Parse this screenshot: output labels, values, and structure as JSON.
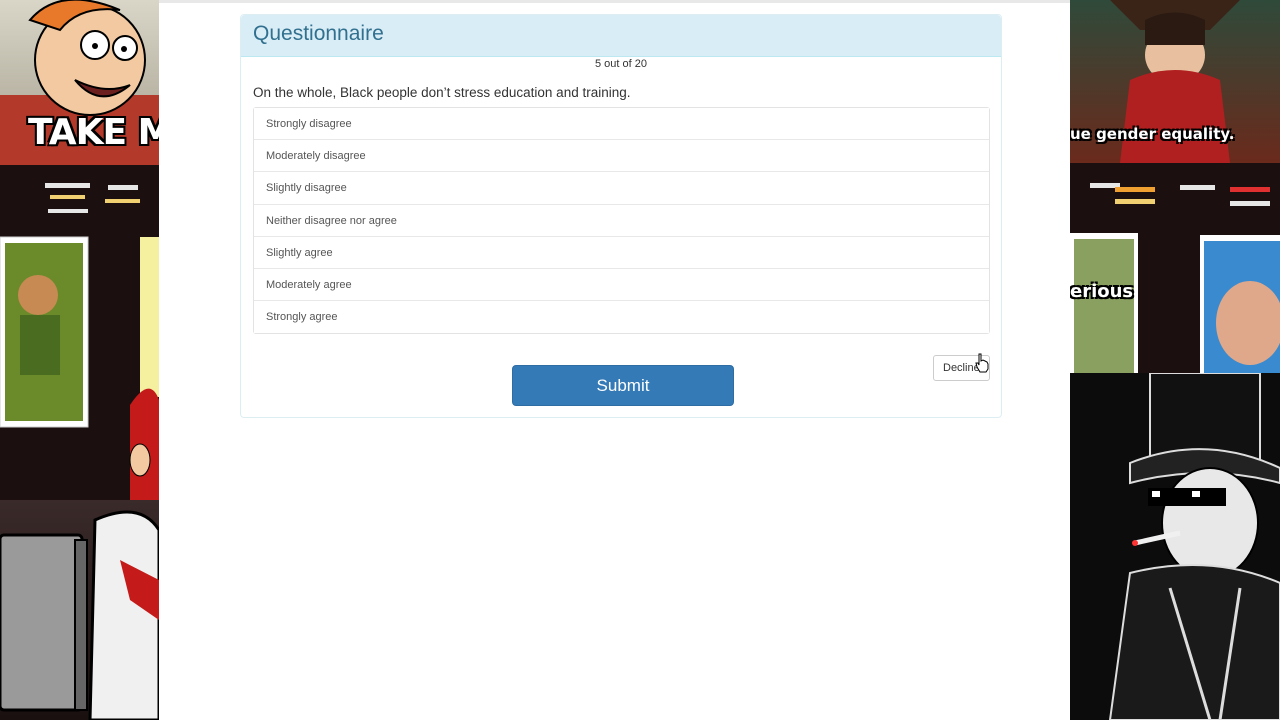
{
  "overlay": {
    "left_top_caption": "TAKE MY",
    "right_top_caption": "ue gender equality.",
    "right_mid_caption": "erious"
  },
  "questionnaire": {
    "title": "Questionnaire",
    "progress": "5 out of 20",
    "question": "On the whole, Black people don’t stress education and training.",
    "options": [
      "Strongly disagree",
      "Moderately disagree",
      "Slightly disagree",
      "Neither disagree nor agree",
      "Slightly agree",
      "Moderately agree",
      "Strongly agree"
    ],
    "submit_label": "Submit",
    "decline_label": "Decline"
  },
  "colors": {
    "heading_bg": "#d9edf7",
    "heading_text": "#31708f",
    "submit_bg": "#337ab7"
  }
}
